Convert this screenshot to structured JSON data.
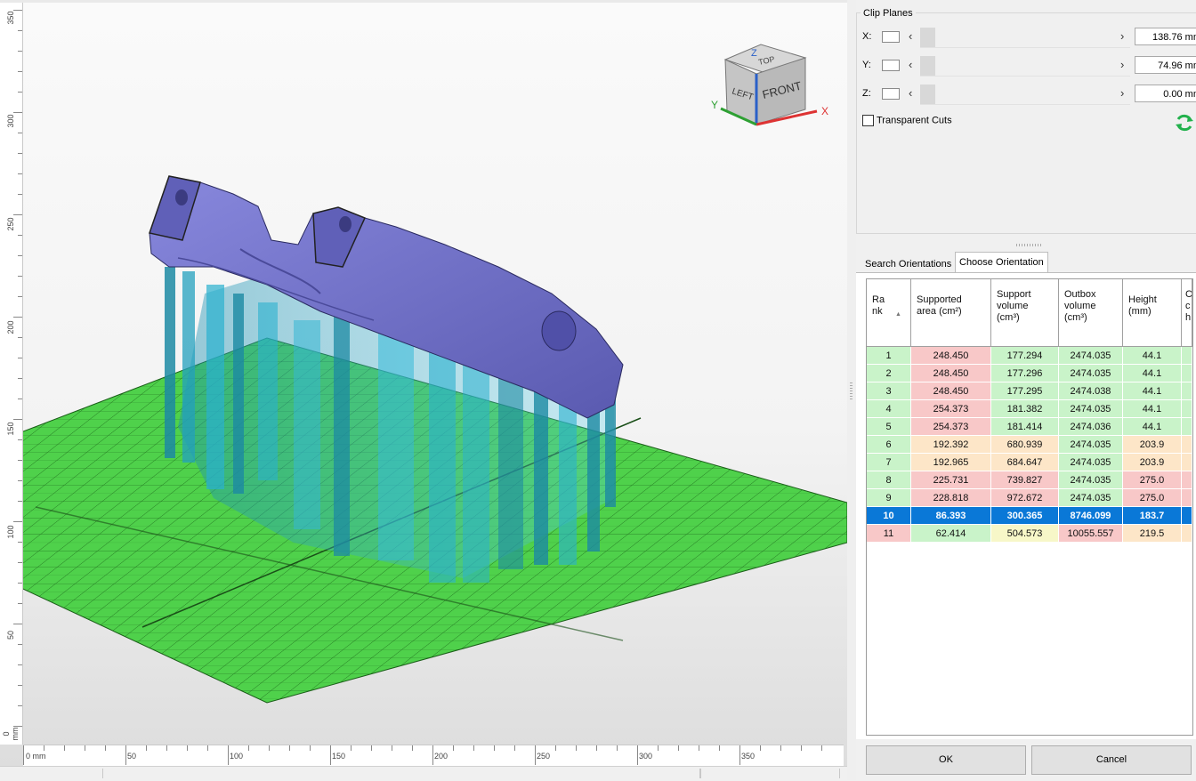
{
  "viewport": {
    "vertical_ruler_labels": [
      "350",
      "300",
      "250",
      "200",
      "150",
      "100",
      "50",
      "0 mm"
    ],
    "horizontal_ruler_labels": [
      "0 mm",
      "50",
      "100",
      "150",
      "200",
      "250",
      "300",
      "350"
    ],
    "view_cube": {
      "top": "TOP",
      "left": "LEFT",
      "front": "FRONT",
      "axis_x": "X",
      "axis_y": "Y",
      "axis_z": "Z"
    },
    "colors": {
      "build_plate": "#4fd14b",
      "part": "#7272c8",
      "supports": "#2aa6c8"
    }
  },
  "clip_planes": {
    "title": "Clip Planes",
    "rows": [
      {
        "axis": "X:",
        "value": "138.76 mm"
      },
      {
        "axis": "Y:",
        "value": "74.96 mm"
      },
      {
        "axis": "Z:",
        "value": "0.00 mm"
      }
    ],
    "transparent_cuts": "Transparent Cuts",
    "arrow_left": "‹",
    "arrow_right": "›"
  },
  "tabs": [
    "Search Orientations",
    "Choose Orientation"
  ],
  "orientation_table": {
    "columns": [
      "Ra\nnk",
      "Supported\narea (cm²)",
      "Support\nvolume\n(cm³)",
      "Outbox\nvolume\n(cm³)",
      "Height\n(mm)",
      "C\nc\nh"
    ],
    "sort_indicator": "▲",
    "rows": [
      {
        "rank": "1",
        "area": "248.450",
        "support_volume": "177.294",
        "outbox_volume": "2474.035",
        "height": "44.1"
      },
      {
        "rank": "2",
        "area": "248.450",
        "support_volume": "177.296",
        "outbox_volume": "2474.035",
        "height": "44.1"
      },
      {
        "rank": "3",
        "area": "248.450",
        "support_volume": "177.295",
        "outbox_volume": "2474.038",
        "height": "44.1"
      },
      {
        "rank": "4",
        "area": "254.373",
        "support_volume": "181.382",
        "outbox_volume": "2474.035",
        "height": "44.1"
      },
      {
        "rank": "5",
        "area": "254.373",
        "support_volume": "181.414",
        "outbox_volume": "2474.036",
        "height": "44.1"
      },
      {
        "rank": "6",
        "area": "192.392",
        "support_volume": "680.939",
        "outbox_volume": "2474.035",
        "height": "203.9"
      },
      {
        "rank": "7",
        "area": "192.965",
        "support_volume": "684.647",
        "outbox_volume": "2474.035",
        "height": "203.9"
      },
      {
        "rank": "8",
        "area": "225.731",
        "support_volume": "739.827",
        "outbox_volume": "2474.035",
        "height": "275.0"
      },
      {
        "rank": "9",
        "area": "228.818",
        "support_volume": "972.672",
        "outbox_volume": "2474.035",
        "height": "275.0"
      },
      {
        "rank": "10",
        "area": "86.393",
        "support_volume": "300.365",
        "outbox_volume": "8746.099",
        "height": "183.7",
        "selected": true
      },
      {
        "rank": "11",
        "area": "62.414",
        "support_volume": "504.573",
        "outbox_volume": "10055.557",
        "height": "219.5"
      }
    ],
    "row_colors": [
      [
        "#c9f3c9",
        "#f8c8c8",
        "#c9f3c9",
        "#c9f3c9",
        "#c9f3c9",
        "#c9f3c9"
      ],
      [
        "#c9f3c9",
        "#f8c8c8",
        "#c9f3c9",
        "#c9f3c9",
        "#c9f3c9",
        "#c9f3c9"
      ],
      [
        "#c9f3c9",
        "#f8c8c8",
        "#c9f3c9",
        "#c9f3c9",
        "#c9f3c9",
        "#c9f3c9"
      ],
      [
        "#c9f3c9",
        "#f8c8c8",
        "#c9f3c9",
        "#c9f3c9",
        "#c9f3c9",
        "#c9f3c9"
      ],
      [
        "#c9f3c9",
        "#f8c8c8",
        "#c9f3c9",
        "#c9f3c9",
        "#c9f3c9",
        "#c9f3c9"
      ],
      [
        "#c9f3c9",
        "#fde6c8",
        "#fde6c8",
        "#c9f3c9",
        "#fde6c8",
        "#fde6c8"
      ],
      [
        "#c9f3c9",
        "#fde6c8",
        "#fde6c8",
        "#c9f3c9",
        "#fde6c8",
        "#fde6c8"
      ],
      [
        "#c9f3c9",
        "#f8c8c8",
        "#f8c8c8",
        "#c9f3c9",
        "#f8c8c8",
        "#f8c8c8"
      ],
      [
        "#c9f3c9",
        "#f8c8c8",
        "#f8c8c8",
        "#c9f3c9",
        "#f8c8c8",
        "#f8c8c8"
      ],
      [
        "#0a78d7",
        "#0a78d7",
        "#0a78d7",
        "#0a78d7",
        "#0a78d7",
        "#0a78d7"
      ],
      [
        "#f8c8c8",
        "#c9f3c9",
        "#f7f7c8",
        "#f8c8c8",
        "#fde6c8",
        "#fde6c8"
      ]
    ]
  },
  "buttons": {
    "ok": "OK",
    "cancel": "Cancel"
  }
}
